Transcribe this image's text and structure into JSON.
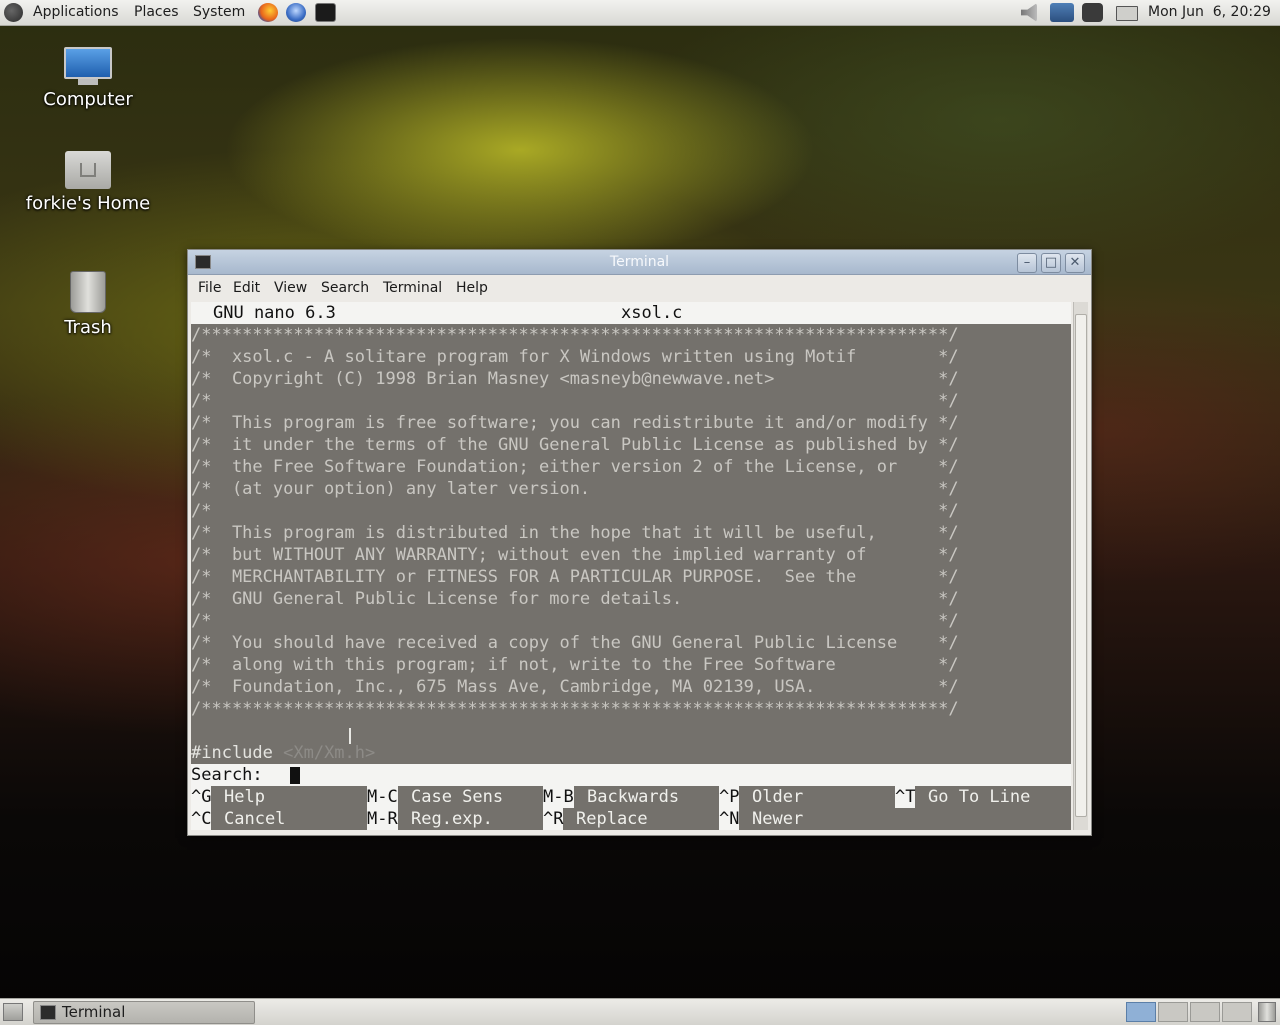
{
  "top_panel": {
    "menus": [
      "Applications",
      "Places",
      "System"
    ],
    "clock": "Mon Jun  6, 20:29"
  },
  "desktop": {
    "icons": [
      {
        "label": "Computer",
        "icon": "computer-icon"
      },
      {
        "label": "forkie's Home",
        "icon": "home-folder-icon"
      },
      {
        "label": "Trash",
        "icon": "trash-icon"
      }
    ]
  },
  "window": {
    "title": "Terminal",
    "menu": [
      "File",
      "Edit",
      "View",
      "Search",
      "Terminal",
      "Help"
    ]
  },
  "nano": {
    "version": "GNU nano 6.3",
    "filename": "xsol.c",
    "lines": [
      "/*************************************************************************/",
      "/*  xsol.c - A solitare program for X Windows written using Motif        */",
      "/*  Copyright (C) 1998 Brian Masney <masneyb@newwave.net>                */",
      "/*                                                                       */",
      "/*  This program is free software; you can redistribute it and/or modify */",
      "/*  it under the terms of the GNU General Public License as published by */",
      "/*  the Free Software Foundation; either version 2 of the License, or    */",
      "/*  (at your option) any later version.                                  */",
      "/*                                                                       */",
      "/*  This program is distributed in the hope that it will be useful,      */",
      "/*  but WITHOUT ANY WARRANTY; without even the implied warranty of       */",
      "/*  MERCHANTABILITY or FITNESS FOR A PARTICULAR PURPOSE.  See the        */",
      "/*  GNU General Public License for more details.                         */",
      "/*                                                                       */",
      "/*  You should have received a copy of the GNU General Public License    */",
      "/*  along with this program; if not, write to the Free Software          */",
      "/*  Foundation, Inc., 675 Mass Ave, Cambridge, MA 02139, USA.            */",
      "/*************************************************************************/",
      "",
      "#include <Xm/Xm.h>"
    ],
    "search_prompt": "Search:",
    "shortcuts": [
      {
        "key": "^G",
        "label": "Help"
      },
      {
        "key": "M-C",
        "label": "Case Sens"
      },
      {
        "key": "M-B",
        "label": "Backwards"
      },
      {
        "key": "^P",
        "label": "Older"
      },
      {
        "key": "^T",
        "label": "Go To Line"
      },
      {
        "key": "^C",
        "label": "Cancel"
      },
      {
        "key": "M-R",
        "label": "Reg.exp."
      },
      {
        "key": "^R",
        "label": "Replace"
      },
      {
        "key": "^N",
        "label": "Newer"
      }
    ]
  },
  "taskbar": {
    "task": "Terminal"
  },
  "colors": {
    "comment": "#c9c7c2",
    "include_keyword": "#e4e4e0",
    "include_path": "#8d8b87"
  }
}
